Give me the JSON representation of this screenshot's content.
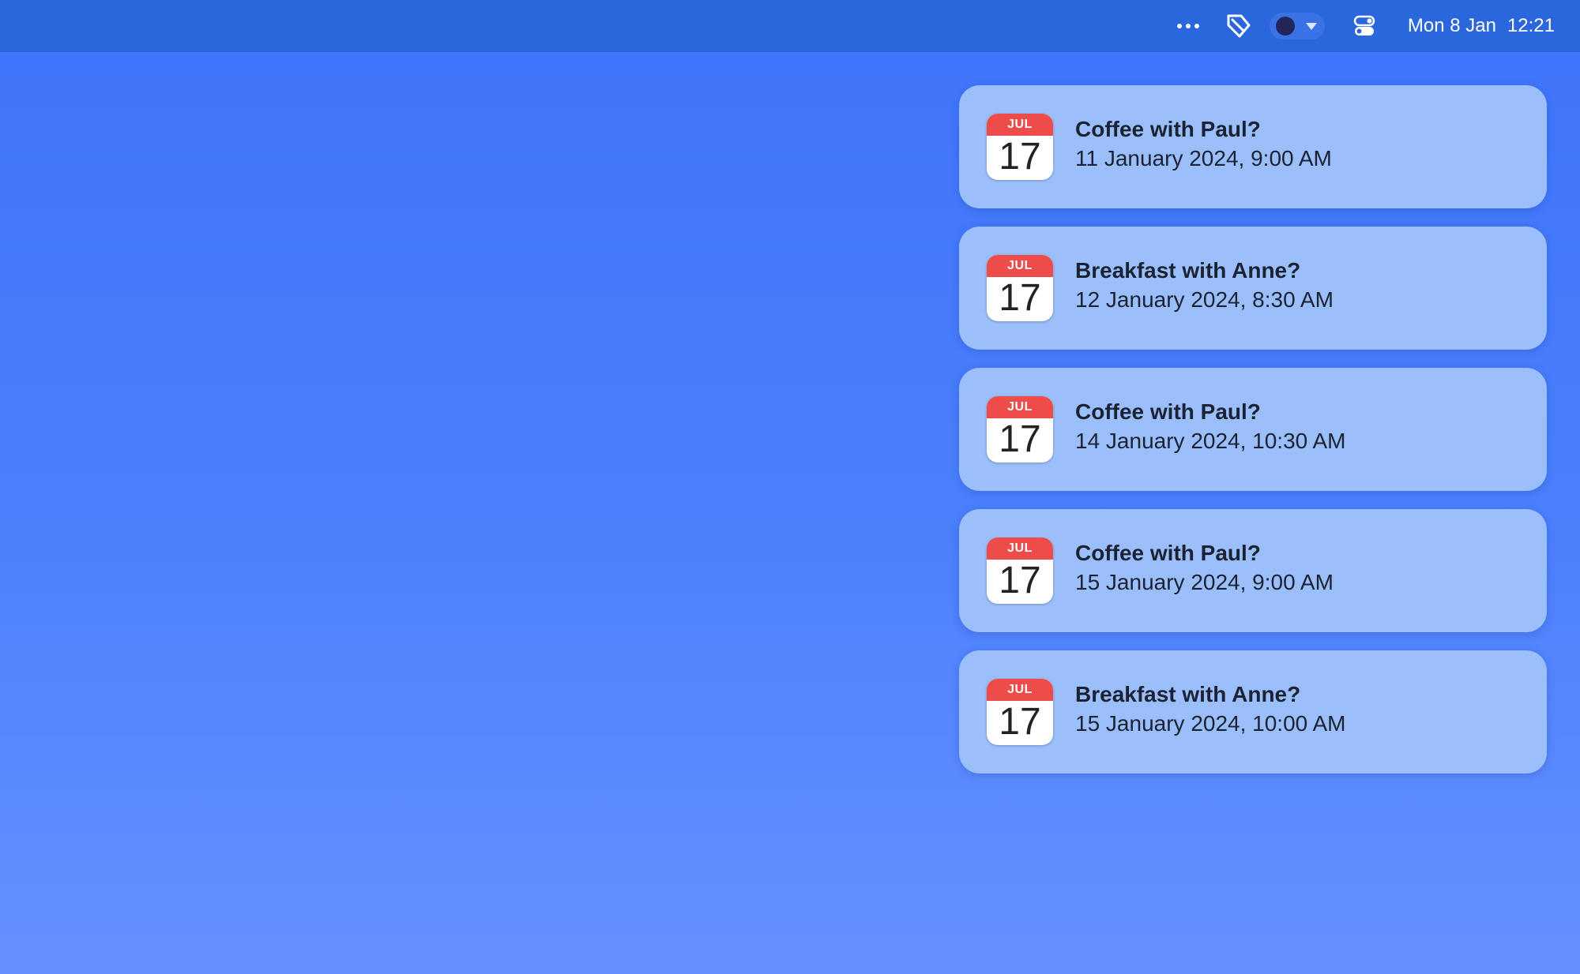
{
  "menubar": {
    "icons": {
      "more": "ellipsis-icon",
      "tag": "tag-icon",
      "focus": "focus-toggle-icon",
      "control_center": "control-center-icon"
    },
    "date": "Mon 8 Jan",
    "time": "12:21"
  },
  "notifications": [
    {
      "icon": {
        "month": "JUL",
        "day": "17"
      },
      "title": "Coffee with Paul?",
      "subtitle": "11 January 2024, 9:00 AM"
    },
    {
      "icon": {
        "month": "JUL",
        "day": "17"
      },
      "title": "Breakfast with Anne?",
      "subtitle": "12 January 2024, 8:30 AM"
    },
    {
      "icon": {
        "month": "JUL",
        "day": "17"
      },
      "title": "Coffee with Paul?",
      "subtitle": "14 January 2024, 10:30 AM"
    },
    {
      "icon": {
        "month": "JUL",
        "day": "17"
      },
      "title": "Coffee with Paul?",
      "subtitle": "15 January 2024, 9:00 AM"
    },
    {
      "icon": {
        "month": "JUL",
        "day": "17"
      },
      "title": "Breakfast with Anne?",
      "subtitle": "15 January 2024, 10:00 AM"
    }
  ],
  "colors": {
    "menubar": "#2a66dc",
    "desktop_top": "#3f74fb",
    "desktop_bottom": "#6690ff",
    "card": "#9bbffa",
    "calendar_red": "#ee4b4b"
  }
}
